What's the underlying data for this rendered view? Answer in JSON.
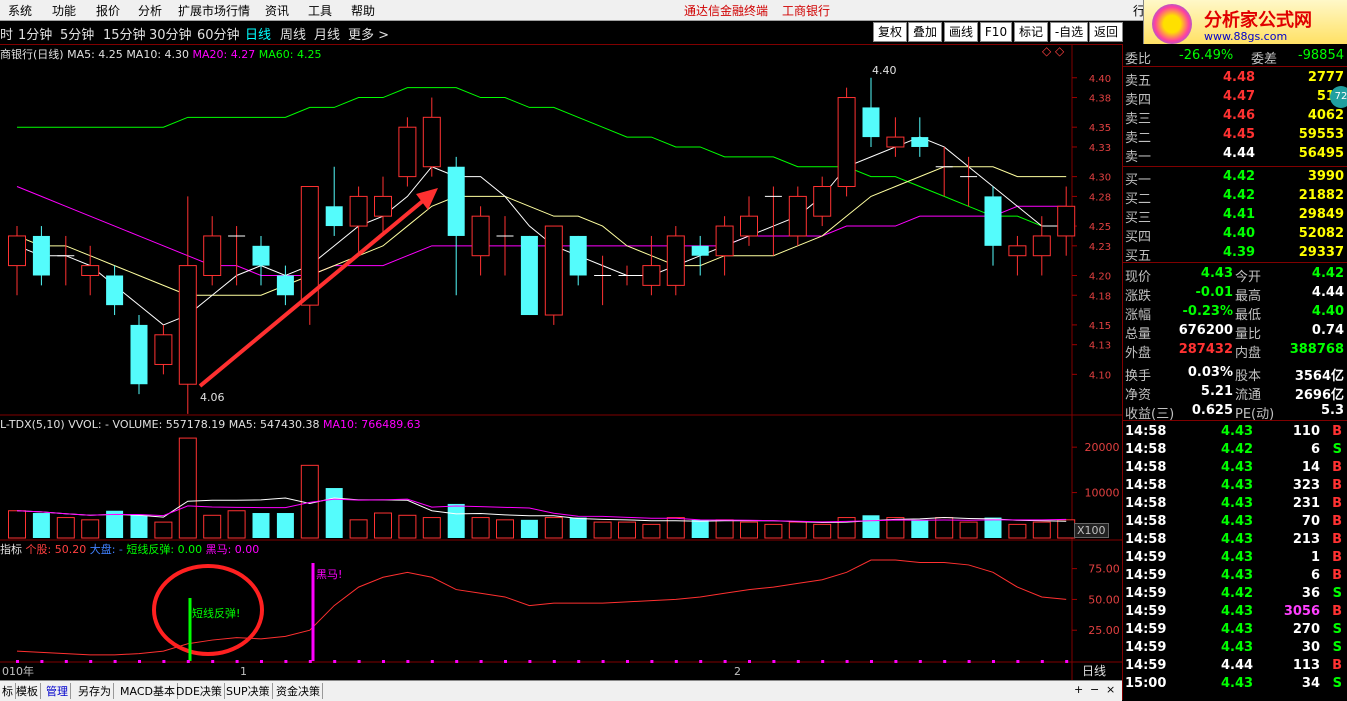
{
  "menu": {
    "items": [
      "系统",
      "功能",
      "报价",
      "分析",
      "扩展市场行情",
      "资讯",
      "工具",
      "帮助"
    ],
    "banner_left": "通达信金融终端",
    "banner_right": "工商银行",
    "right_item": "行"
  },
  "logo": {
    "name": "分析家公式网",
    "url_text": "www.88gs.com",
    "badge": "72"
  },
  "toolbar": {
    "periods": [
      "时",
      "1分钟",
      "5分钟",
      "15分钟",
      "30分钟",
      "60分钟",
      "日线",
      "周线",
      "月线",
      "更多 >"
    ],
    "active_period": "日线",
    "buttons": [
      "复权",
      "叠加",
      "画线",
      "F10",
      "标记",
      "-自选",
      "返回"
    ]
  },
  "main_chart": {
    "title": "商银行(日线)",
    "ma5": "MA5: 4.25",
    "ma10": "MA10: 4.30",
    "ma20": "MA20: 4.27",
    "ma60": "MA60: 4.25",
    "high_label": "4.40",
    "low_label": "4.06",
    "price_axis": [
      "4.40",
      "4.38",
      "4.35",
      "4.33",
      "4.30",
      "4.28",
      "4.25",
      "4.23",
      "4.20",
      "4.18",
      "4.15",
      "4.13",
      "4.10"
    ]
  },
  "volume_chart": {
    "title": "L-TDX(5,10)",
    "vol": "VVOL: -",
    "volume": "VOLUME: 557178.19",
    "ma5": "MA5: 547430.38",
    "ma10": "MA10: 766489.63",
    "axis": [
      "20000",
      "10000"
    ],
    "unit": "X100"
  },
  "indicator": {
    "title": "指标",
    "stock": "个股: 50.20",
    "market": "大盘: -",
    "rebound": "短线反弹: 0.00",
    "darkhorse": "黑马: 0.00",
    "rebound_tag": "短线反弹!",
    "darkhorse_tag": "黑马!",
    "axis": [
      "75.00",
      "50.00",
      "25.00"
    ]
  },
  "date_axis": {
    "year": "010年",
    "m1": "1",
    "m2": "2",
    "period": "日线"
  },
  "quote": {
    "webi_label": "委比",
    "webi_value": "-26.49%",
    "wcha_label": "委差",
    "wcha_value": "-98854",
    "sell": [
      {
        "label": "卖五",
        "price": "4.48",
        "vol": "2777"
      },
      {
        "label": "卖四",
        "price": "4.47",
        "vol": "515"
      },
      {
        "label": "卖三",
        "price": "4.46",
        "vol": "4062"
      },
      {
        "label": "卖二",
        "price": "4.45",
        "vol": "59553"
      },
      {
        "label": "卖一",
        "price": "4.44",
        "vol": "56495"
      }
    ],
    "buy": [
      {
        "label": "买一",
        "price": "4.42",
        "vol": "3990"
      },
      {
        "label": "买二",
        "price": "4.42",
        "vol": "21882"
      },
      {
        "label": "买三",
        "price": "4.41",
        "vol": "29849"
      },
      {
        "label": "买四",
        "price": "4.40",
        "vol": "52082"
      },
      {
        "label": "买五",
        "price": "4.39",
        "vol": "29337"
      }
    ],
    "stats": [
      {
        "l1": "现价",
        "v1": "4.43",
        "l2": "今开",
        "v2": "4.42"
      },
      {
        "l1": "涨跌",
        "v1": "-0.01",
        "l2": "最高",
        "v2": "4.44"
      },
      {
        "l1": "涨幅",
        "v1": "-0.23%",
        "l2": "最低",
        "v2": "4.40"
      },
      {
        "l1": "总量",
        "v1": "676200",
        "l2": "量比",
        "v2": "0.74"
      },
      {
        "l1": "外盘",
        "v1": "287432",
        "l2": "内盘",
        "v2": "388768"
      },
      {
        "l1": "换手",
        "v1": "0.03%",
        "l2": "股本",
        "v2": "3564亿"
      },
      {
        "l1": "净资",
        "v1": "5.21",
        "l2": "流通",
        "v2": "2696亿"
      },
      {
        "l1": "收益(三)",
        "v1": "0.625",
        "l2": "PE(动)",
        "v2": "5.3"
      }
    ],
    "ticks": [
      {
        "t": "14:58",
        "p": "4.43",
        "v": "110",
        "s": "B"
      },
      {
        "t": "14:58",
        "p": "4.42",
        "v": "6",
        "s": "S"
      },
      {
        "t": "14:58",
        "p": "4.43",
        "v": "14",
        "s": "B"
      },
      {
        "t": "14:58",
        "p": "4.43",
        "v": "323",
        "s": "B"
      },
      {
        "t": "14:58",
        "p": "4.43",
        "v": "231",
        "s": "B"
      },
      {
        "t": "14:58",
        "p": "4.43",
        "v": "70",
        "s": "B"
      },
      {
        "t": "14:58",
        "p": "4.43",
        "v": "213",
        "s": "B"
      },
      {
        "t": "14:59",
        "p": "4.43",
        "v": "1",
        "s": "B"
      },
      {
        "t": "14:59",
        "p": "4.43",
        "v": "6",
        "s": "B"
      },
      {
        "t": "14:59",
        "p": "4.42",
        "v": "36",
        "s": "S"
      },
      {
        "t": "14:59",
        "p": "4.43",
        "v": "3056",
        "s": "B"
      },
      {
        "t": "14:59",
        "p": "4.43",
        "v": "270",
        "s": "S"
      },
      {
        "t": "14:59",
        "p": "4.43",
        "v": "30",
        "s": "S"
      },
      {
        "t": "14:59",
        "p": "4.44",
        "v": "113",
        "s": "B"
      },
      {
        "t": "15:00",
        "p": "4.43",
        "v": "34",
        "s": "S"
      }
    ]
  },
  "bottom_tabs": [
    "标",
    "模板",
    "管理",
    "另存为",
    "MACD基本",
    "DDE决策",
    "SUP决策",
    "资金决策"
  ],
  "colors": {
    "up": "#ff3232",
    "down": "#54fcfc",
    "ma5": "#ffffff",
    "ma10": "#ffff00",
    "ma20": "#ff00ff",
    "ma60": "#00ff00"
  },
  "chart_data": {
    "type": "candlestick",
    "ylim": [
      4.07,
      4.42
    ],
    "candles": [
      {
        "o": 4.21,
        "c": 4.24,
        "h": 4.25,
        "l": 4.18,
        "up": true
      },
      {
        "o": 4.2,
        "c": 4.24,
        "h": 4.25,
        "l": 4.19,
        "up": false
      },
      {
        "o": 4.22,
        "c": 4.22,
        "h": 4.24,
        "l": 4.19,
        "up": true
      },
      {
        "o": 4.21,
        "c": 4.2,
        "h": 4.23,
        "l": 4.18,
        "up": true
      },
      {
        "o": 4.2,
        "c": 4.17,
        "h": 4.21,
        "l": 4.16,
        "up": false
      },
      {
        "o": 4.15,
        "c": 4.09,
        "h": 4.16,
        "l": 4.08,
        "up": false
      },
      {
        "o": 4.11,
        "c": 4.14,
        "h": 4.15,
        "l": 4.1,
        "up": true
      },
      {
        "o": 4.09,
        "c": 4.21,
        "h": 4.28,
        "l": 4.06,
        "up": true
      },
      {
        "o": 4.2,
        "c": 4.24,
        "h": 4.26,
        "l": 4.19,
        "up": true
      },
      {
        "o": 4.24,
        "c": 4.24,
        "h": 4.25,
        "l": 4.19,
        "up": true
      },
      {
        "o": 4.23,
        "c": 4.21,
        "h": 4.24,
        "l": 4.19,
        "up": false
      },
      {
        "o": 4.2,
        "c": 4.18,
        "h": 4.21,
        "l": 4.17,
        "up": false
      },
      {
        "o": 4.17,
        "c": 4.29,
        "h": 4.29,
        "l": 4.15,
        "up": true
      },
      {
        "o": 4.27,
        "c": 4.25,
        "h": 4.31,
        "l": 4.24,
        "up": false
      },
      {
        "o": 4.25,
        "c": 4.28,
        "h": 4.29,
        "l": 4.22,
        "up": true
      },
      {
        "o": 4.26,
        "c": 4.28,
        "h": 4.3,
        "l": 4.24,
        "up": true
      },
      {
        "o": 4.3,
        "c": 4.35,
        "h": 4.36,
        "l": 4.29,
        "up": true
      },
      {
        "o": 4.31,
        "c": 4.36,
        "h": 4.38,
        "l": 4.3,
        "up": true
      },
      {
        "o": 4.31,
        "c": 4.24,
        "h": 4.32,
        "l": 4.18,
        "up": false
      },
      {
        "o": 4.22,
        "c": 4.26,
        "h": 4.27,
        "l": 4.2,
        "up": true
      },
      {
        "o": 4.24,
        "c": 4.24,
        "h": 4.26,
        "l": 4.2,
        "up": true
      },
      {
        "o": 4.24,
        "c": 4.16,
        "h": 4.24,
        "l": 4.16,
        "up": false
      },
      {
        "o": 4.16,
        "c": 4.25,
        "h": 4.25,
        "l": 4.15,
        "up": true
      },
      {
        "o": 4.24,
        "c": 4.2,
        "h": 4.24,
        "l": 4.19,
        "up": false
      },
      {
        "o": 4.2,
        "c": 4.2,
        "h": 4.22,
        "l": 4.17,
        "up": true
      },
      {
        "o": 4.2,
        "c": 4.2,
        "h": 4.21,
        "l": 4.19,
        "up": true
      },
      {
        "o": 4.19,
        "c": 4.21,
        "h": 4.24,
        "l": 4.18,
        "up": true
      },
      {
        "o": 4.19,
        "c": 4.24,
        "h": 4.25,
        "l": 4.18,
        "up": true
      },
      {
        "o": 4.23,
        "c": 4.22,
        "h": 4.24,
        "l": 4.2,
        "up": false
      },
      {
        "o": 4.22,
        "c": 4.25,
        "h": 4.26,
        "l": 4.2,
        "up": true
      },
      {
        "o": 4.24,
        "c": 4.26,
        "h": 4.28,
        "l": 4.23,
        "up": true
      },
      {
        "o": 4.28,
        "c": 4.28,
        "h": 4.29,
        "l": 4.22,
        "up": true
      },
      {
        "o": 4.24,
        "c": 4.28,
        "h": 4.29,
        "l": 4.23,
        "up": true
      },
      {
        "o": 4.26,
        "c": 4.29,
        "h": 4.3,
        "l": 4.25,
        "up": true
      },
      {
        "o": 4.29,
        "c": 4.38,
        "h": 4.39,
        "l": 4.28,
        "up": true
      },
      {
        "o": 4.37,
        "c": 4.34,
        "h": 4.4,
        "l": 4.33,
        "up": false
      },
      {
        "o": 4.33,
        "c": 4.34,
        "h": 4.36,
        "l": 4.32,
        "up": true
      },
      {
        "o": 4.34,
        "c": 4.33,
        "h": 4.36,
        "l": 4.32,
        "up": false
      },
      {
        "o": 4.31,
        "c": 4.31,
        "h": 4.33,
        "l": 4.28,
        "up": true
      },
      {
        "o": 4.3,
        "c": 4.3,
        "h": 4.32,
        "l": 4.27,
        "up": true
      },
      {
        "o": 4.28,
        "c": 4.23,
        "h": 4.29,
        "l": 4.21,
        "up": false
      },
      {
        "o": 4.22,
        "c": 4.23,
        "h": 4.24,
        "l": 4.2,
        "up": true
      },
      {
        "o": 4.22,
        "c": 4.24,
        "h": 4.26,
        "l": 4.2,
        "up": true
      },
      {
        "o": 4.24,
        "c": 4.27,
        "h": 4.29,
        "l": 4.22,
        "up": true
      }
    ],
    "ma5": [
      4.23,
      4.22,
      4.22,
      4.21,
      4.19,
      4.17,
      4.15,
      4.16,
      4.18,
      4.2,
      4.21,
      4.2,
      4.21,
      4.23,
      4.25,
      4.26,
      4.28,
      4.31,
      4.3,
      4.3,
      4.28,
      4.25,
      4.23,
      4.22,
      4.21,
      4.2,
      4.2,
      4.21,
      4.22,
      4.23,
      4.24,
      4.25,
      4.26,
      4.28,
      4.31,
      4.32,
      4.33,
      4.34,
      4.33,
      4.31,
      4.29,
      4.27,
      4.25,
      4.25
    ],
    "ma10": [
      4.24,
      4.23,
      4.23,
      4.22,
      4.21,
      4.2,
      4.19,
      4.18,
      4.18,
      4.18,
      4.18,
      4.19,
      4.2,
      4.21,
      4.22,
      4.23,
      4.25,
      4.27,
      4.28,
      4.28,
      4.28,
      4.27,
      4.26,
      4.26,
      4.25,
      4.23,
      4.22,
      4.21,
      4.21,
      4.22,
      4.22,
      4.22,
      4.23,
      4.24,
      4.26,
      4.28,
      4.29,
      4.3,
      4.31,
      4.31,
      4.31,
      4.3,
      4.3,
      4.3
    ],
    "ma20": [
      4.29,
      4.28,
      4.27,
      4.26,
      4.25,
      4.24,
      4.23,
      4.22,
      4.21,
      4.21,
      4.2,
      4.2,
      4.2,
      4.21,
      4.21,
      4.21,
      4.22,
      4.23,
      4.23,
      4.23,
      4.23,
      4.23,
      4.23,
      4.23,
      4.23,
      4.23,
      4.23,
      4.23,
      4.23,
      4.23,
      4.24,
      4.24,
      4.24,
      4.24,
      4.25,
      4.25,
      4.25,
      4.26,
      4.26,
      4.26,
      4.26,
      4.27,
      4.27,
      4.27
    ],
    "ma60": [
      4.35,
      4.35,
      4.35,
      4.35,
      4.35,
      4.35,
      4.35,
      4.36,
      4.36,
      4.36,
      4.36,
      4.36,
      4.37,
      4.37,
      4.38,
      4.38,
      4.39,
      4.39,
      4.39,
      4.38,
      4.38,
      4.37,
      4.37,
      4.36,
      4.35,
      4.34,
      4.34,
      4.33,
      4.33,
      4.32,
      4.32,
      4.32,
      4.31,
      4.31,
      4.31,
      4.3,
      4.3,
      4.29,
      4.28,
      4.27,
      4.26,
      4.26,
      4.25,
      4.25
    ],
    "volume": [
      6000,
      5500,
      4500,
      4000,
      6000,
      5000,
      3500,
      22000,
      5000,
      6000,
      5500,
      5500,
      16000,
      11000,
      4000,
      5500,
      5000,
      4500,
      7500,
      4500,
      4000,
      4000,
      4500,
      4500,
      3500,
      3500,
      3000,
      4500,
      4000,
      4000,
      3500,
      3000,
      3500,
      3000,
      4500,
      5000,
      4500,
      4000,
      4500,
      3500,
      4500,
      3000,
      3500,
      4000
    ],
    "ind_line": [
      8,
      7,
      6,
      5,
      5,
      6,
      8,
      14,
      17,
      19,
      18,
      20,
      25,
      45,
      60,
      68,
      72,
      68,
      58,
      55,
      52,
      45,
      47,
      47,
      47,
      48,
      49,
      50,
      52,
      55,
      58,
      60,
      63,
      66,
      72,
      82,
      82,
      80,
      80,
      78,
      72,
      60,
      52,
      50
    ]
  }
}
